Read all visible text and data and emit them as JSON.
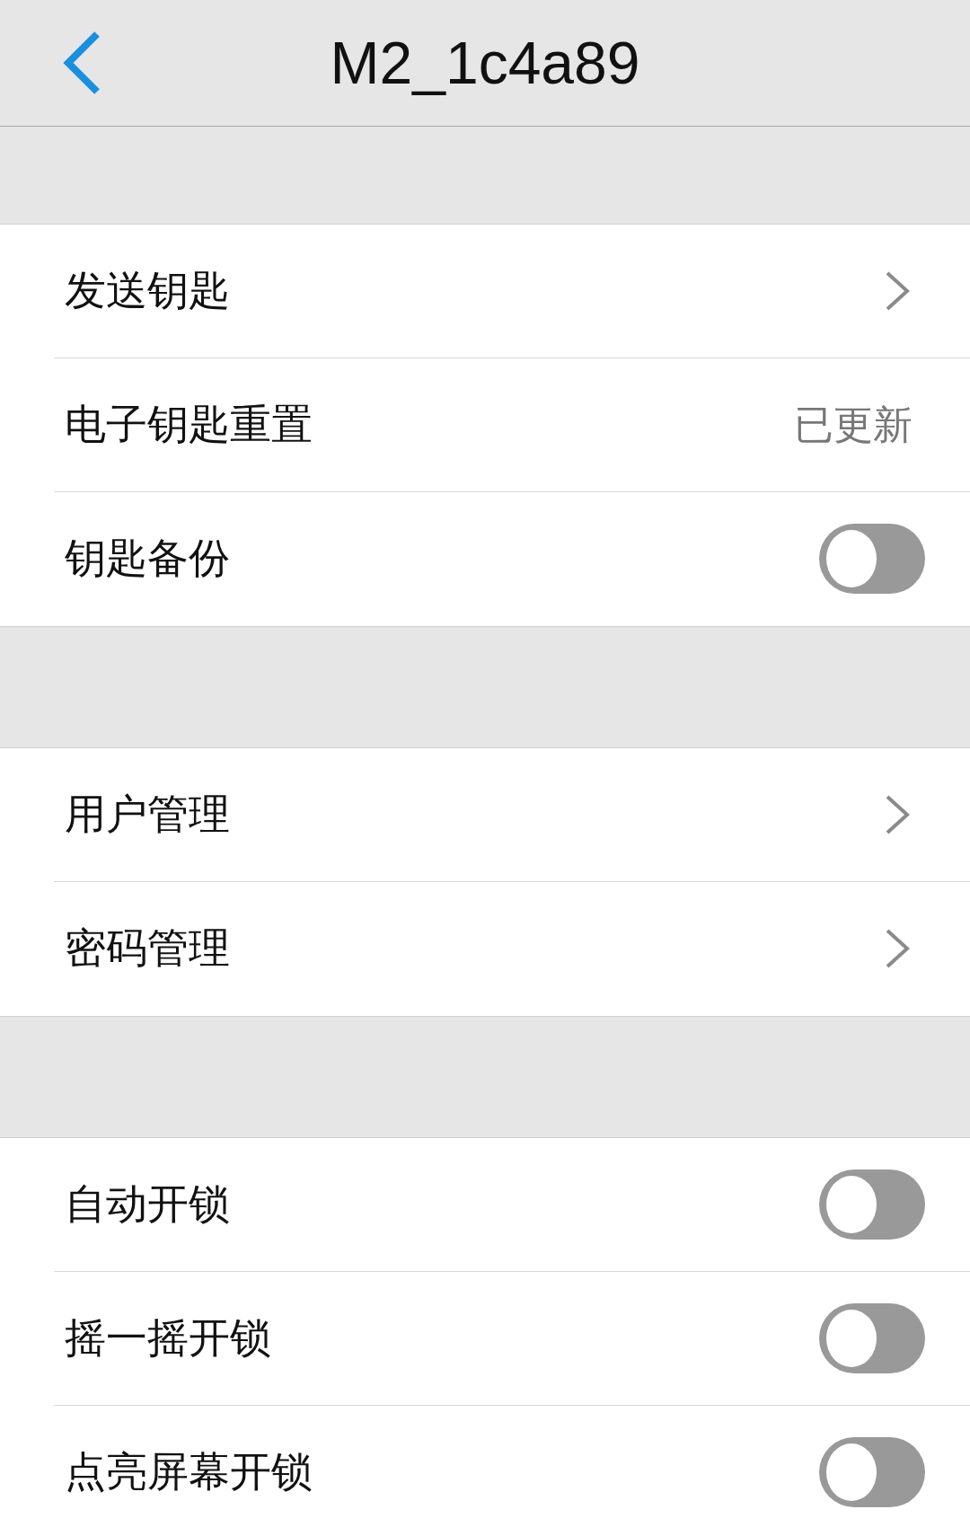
{
  "header": {
    "title": "M2_1c4a89"
  },
  "sections": [
    {
      "items": [
        {
          "kind": "link",
          "label": "发送钥匙"
        },
        {
          "kind": "value",
          "label": "电子钥匙重置",
          "value": "已更新"
        },
        {
          "kind": "toggle",
          "label": "钥匙备份",
          "on": false
        }
      ]
    },
    {
      "items": [
        {
          "kind": "link",
          "label": "用户管理"
        },
        {
          "kind": "link",
          "label": "密码管理"
        }
      ]
    },
    {
      "items": [
        {
          "kind": "toggle",
          "label": "自动开锁",
          "on": false
        },
        {
          "kind": "toggle",
          "label": "摇一摇开锁",
          "on": false
        },
        {
          "kind": "toggle",
          "label": "点亮屏幕开锁",
          "on": false
        }
      ]
    }
  ]
}
